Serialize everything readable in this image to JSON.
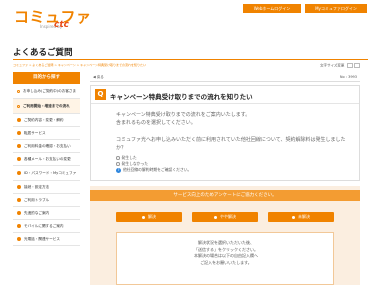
{
  "header": {
    "logo": "コミュファ",
    "logo_sub": "Inspired by",
    "logo_brand": "ctc",
    "btn_web_login": "Webホームログイン",
    "btn_my_login": "Myコミュファログイン"
  },
  "page_title": "よくあるご質問",
  "breadcrumb": "コミュファ > よくあるご質問 > キャンペーン > キャンペーン特典受け取りまでの流れを知りたい",
  "font_size_label": "文字サイズ変更",
  "sidebar": {
    "heading": "目的から探す",
    "items": [
      {
        "label": "お申し込み(ご契約中)のお客さま",
        "plain": true
      },
      {
        "label": "ご利用開始・増速までの流れ",
        "plain": true,
        "active": true
      },
      {
        "label": "ご契約内容・変更・解約"
      },
      {
        "label": "転居サービス"
      },
      {
        "label": "ご利用料金の確認・お支払い"
      },
      {
        "label": "各種メール・お支払いの変更"
      },
      {
        "label": "ID・パスワード・Myコミュファ"
      },
      {
        "label": "接続・設定方法"
      },
      {
        "label": "ご利用トラブル"
      },
      {
        "label": "先進的なご案内"
      },
      {
        "label": "モバイルに関するご案内"
      },
      {
        "label": "光電話・関連サービス"
      }
    ]
  },
  "main": {
    "back_label": "戻る",
    "question_no": "No : 3993",
    "q_badge": "Q",
    "question_title": "キャンペーン特典受け取りまでの流れを知りたい",
    "answer_line1": "キャンペーン特典受け取りまでの流れをご案内いたします。",
    "answer_line2": "含まれるものを選択してください。",
    "answer_line3": "コミュファ光へお申し込みいただく前に利用されていた他社回線について、契約解除料は発生しましたか？",
    "answer_line4": "か？",
    "feedback_options": [
      "発生した",
      "発生しなかった"
    ],
    "feedback_help": "他社回線の解約時期をご確認ください。"
  },
  "survey": {
    "heading": "サービス向上のためアンケートにご協力ください。",
    "buttons": [
      "解決",
      "やや解決",
      "未解決"
    ],
    "text": [
      "解決状況を選択いただいた後、",
      "「送信する」をクリックください。",
      "本解決の場合は以下の自由記入欄へ",
      "ご記入をお願いいたします。"
    ]
  },
  "colors": {
    "brand_orange": "#f08300",
    "survey_bg": "#fbeee0"
  }
}
